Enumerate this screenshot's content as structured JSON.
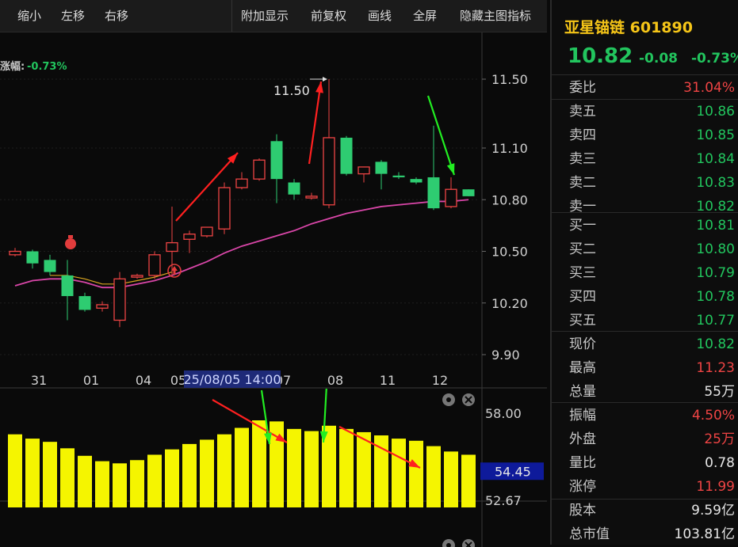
{
  "toolbar": {
    "buttons": [
      "缩小",
      "左移",
      "右移",
      "附加显示",
      "前复权",
      "画线",
      "全屏",
      "隐藏主图指标"
    ]
  },
  "price_chart": {
    "change_label": "涨幅:",
    "change_value": "-0.73%",
    "y_ticks": [
      "11.50",
      "11.10",
      "10.80",
      "10.50",
      "10.20",
      "9.90"
    ],
    "x_ticks": [
      "31",
      "01",
      "04",
      "05",
      "07",
      "08",
      "11",
      "12"
    ],
    "crosshair_date": "25/08/05 14:00",
    "high_label": "11.50"
  },
  "volume_chart": {
    "y_ticks": [
      "58.00",
      "52.67"
    ],
    "current": "54.45"
  },
  "chart_data": {
    "type": "bar",
    "candles": [
      {
        "o": 10.48,
        "h": 10.52,
        "l": 10.47,
        "c": 10.5
      },
      {
        "o": 10.5,
        "h": 10.51,
        "l": 10.4,
        "c": 10.43
      },
      {
        "o": 10.45,
        "h": 10.48,
        "l": 10.36,
        "c": 10.38
      },
      {
        "o": 10.36,
        "h": 10.45,
        "l": 10.1,
        "c": 10.24
      },
      {
        "o": 10.24,
        "h": 10.26,
        "l": 10.15,
        "c": 10.16
      },
      {
        "o": 10.17,
        "h": 10.21,
        "l": 10.15,
        "c": 10.19
      },
      {
        "o": 10.1,
        "h": 10.38,
        "l": 10.06,
        "c": 10.34
      },
      {
        "o": 10.35,
        "h": 10.37,
        "l": 10.34,
        "c": 10.36
      },
      {
        "o": 10.36,
        "h": 10.5,
        "l": 10.34,
        "c": 10.48
      },
      {
        "o": 10.5,
        "h": 10.76,
        "l": 10.36,
        "c": 10.55
      },
      {
        "o": 10.57,
        "h": 10.62,
        "l": 10.49,
        "c": 10.6
      },
      {
        "o": 10.59,
        "h": 10.64,
        "l": 10.58,
        "c": 10.64
      },
      {
        "o": 10.63,
        "h": 10.9,
        "l": 10.6,
        "c": 10.87
      },
      {
        "o": 10.87,
        "h": 10.96,
        "l": 10.86,
        "c": 10.92
      },
      {
        "o": 10.92,
        "h": 11.04,
        "l": 10.91,
        "c": 11.03
      },
      {
        "o": 11.14,
        "h": 11.18,
        "l": 10.78,
        "c": 10.92
      },
      {
        "o": 10.9,
        "h": 10.92,
        "l": 10.8,
        "c": 10.83
      },
      {
        "o": 10.81,
        "h": 10.84,
        "l": 10.8,
        "c": 10.82
      },
      {
        "o": 10.77,
        "h": 11.5,
        "l": 10.75,
        "c": 11.16
      },
      {
        "o": 11.16,
        "h": 11.17,
        "l": 10.94,
        "c": 10.95
      },
      {
        "o": 10.95,
        "h": 10.99,
        "l": 10.9,
        "c": 10.99
      },
      {
        "o": 11.02,
        "h": 11.03,
        "l": 10.86,
        "c": 10.95
      },
      {
        "o": 10.94,
        "h": 10.96,
        "l": 10.92,
        "c": 10.93
      },
      {
        "o": 10.92,
        "h": 10.93,
        "l": 10.89,
        "c": 10.9
      },
      {
        "o": 10.93,
        "h": 11.23,
        "l": 10.74,
        "c": 10.75
      },
      {
        "o": 10.76,
        "h": 10.93,
        "l": 10.75,
        "c": 10.86
      },
      {
        "o": 10.86,
        "h": 10.86,
        "l": 10.82,
        "c": 10.82
      }
    ],
    "ma": [
      10.3,
      10.33,
      10.34,
      10.34,
      10.32,
      10.29,
      10.29,
      10.31,
      10.33,
      10.36,
      10.4,
      10.44,
      10.49,
      10.53,
      10.56,
      10.59,
      10.62,
      10.66,
      10.69,
      10.72,
      10.74,
      10.76,
      10.77,
      10.78,
      10.79,
      10.79,
      10.8
    ],
    "volume": [
      57.3,
      56.9,
      56.6,
      56.0,
      55.3,
      54.8,
      54.6,
      54.9,
      55.4,
      55.9,
      56.4,
      56.8,
      57.3,
      57.9,
      58.6,
      58.5,
      57.8,
      57.6,
      58.1,
      57.8,
      57.5,
      57.2,
      56.9,
      56.7,
      56.2,
      55.7,
      55.4
    ],
    "ylim": [
      9.9,
      11.5
    ],
    "vol_ylim": [
      52.67,
      58.0
    ]
  },
  "quote": {
    "name": "亚星锚链",
    "code": "601890",
    "price": "10.82",
    "change": "-0.08",
    "pct": "-0.73%",
    "rows": [
      {
        "label": "委比",
        "value": "31.04%",
        "color": "red"
      },
      {
        "label": "卖五",
        "value": "10.86",
        "color": "green"
      },
      {
        "label": "卖四",
        "value": "10.85",
        "color": "green"
      },
      {
        "label": "卖三",
        "value": "10.84",
        "color": "green"
      },
      {
        "label": "卖二",
        "value": "10.83",
        "color": "green"
      },
      {
        "label": "卖一",
        "value": "10.82",
        "color": "green"
      },
      {
        "label": "买一",
        "value": "10.81",
        "color": "green"
      },
      {
        "label": "买二",
        "value": "10.80",
        "color": "green"
      },
      {
        "label": "买三",
        "value": "10.79",
        "color": "green"
      },
      {
        "label": "买四",
        "value": "10.78",
        "color": "green"
      },
      {
        "label": "买五",
        "value": "10.77",
        "color": "green"
      },
      {
        "label": "现价",
        "value": "10.82",
        "color": "green"
      },
      {
        "label": "最高",
        "value": "11.23",
        "color": "red"
      },
      {
        "label": "总量",
        "value": "55万",
        "color": "white"
      },
      {
        "label": "振幅",
        "value": "4.50%",
        "color": "red"
      },
      {
        "label": "外盘",
        "value": "25万",
        "color": "red"
      },
      {
        "label": "量比",
        "value": "0.78",
        "color": "white"
      },
      {
        "label": "涨停",
        "value": "11.99",
        "color": "red"
      },
      {
        "label": "股本",
        "value": "9.59亿",
        "color": "white"
      },
      {
        "label": "总市值",
        "value": "103.81亿",
        "color": "white"
      }
    ]
  }
}
